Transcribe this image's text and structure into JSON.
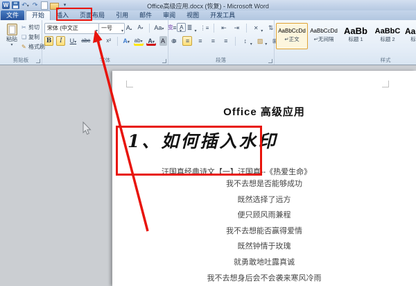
{
  "window_title": "Office高级应用.docx (恢复) - Microsoft Word",
  "annotation_color": "#e8140c",
  "qat": {
    "icons": [
      "word-logo",
      "save",
      "undo",
      "redo",
      "new-document",
      "open-folder",
      "customize-menu"
    ]
  },
  "tabs": [
    {
      "label": "文件"
    },
    {
      "label": "开始"
    },
    {
      "label": "插入"
    },
    {
      "label": "页面布局"
    },
    {
      "label": "引用"
    },
    {
      "label": "邮件"
    },
    {
      "label": "审阅"
    },
    {
      "label": "视图"
    },
    {
      "label": "开发工具"
    }
  ],
  "ribbon": {
    "clipboard": {
      "group_label": "剪贴板",
      "paste_label": "粘贴",
      "cut_label": "剪切",
      "copy_label": "复制",
      "format_painter_label": "格式刷"
    },
    "font": {
      "group_label": "字体",
      "font_name_value": "宋体 (中文正",
      "font_size_value": "一号",
      "grow_font_label": "A",
      "shrink_font_label": "A",
      "change_case_label": "Aa",
      "phonetic_label": "变",
      "char_border_label": "A",
      "bold_label": "B",
      "italic_label": "I",
      "underline_label": "U",
      "strikethrough_label": "abc",
      "subscript_label": "x₂",
      "superscript_label": "x²",
      "text_effects_label": "A",
      "highlight_label": "ab",
      "font_color_label": "A",
      "char_shading_label": "A",
      "enclose_label": "⊕"
    },
    "paragraph": {
      "group_label": "段落"
    },
    "styles": {
      "group_label": "样式",
      "items": [
        {
          "preview": "AaBbCcDd",
          "name": "↵正文"
        },
        {
          "preview": "AaBbCcDd",
          "name": "↵无间隔"
        },
        {
          "preview": "AaBb",
          "name": "标题 1"
        },
        {
          "preview": "AaBbC",
          "name": "标题 2"
        },
        {
          "preview": "AaB",
          "name": "标"
        }
      ]
    }
  },
  "document": {
    "title": "Office 高级应用",
    "heading": "1、如何插入水印",
    "subtitle": "汪国真经典诗文【一】汪国真--《热爱生命》",
    "poem": [
      "我不去想是否能够成功",
      "既然选择了远方",
      "便只顾风雨兼程",
      "我不去想能否赢得爱情",
      "既然钟情于玫瑰",
      "就勇敢地吐露真诚",
      "我不去想身后会不会袭来寒风冷雨"
    ]
  }
}
